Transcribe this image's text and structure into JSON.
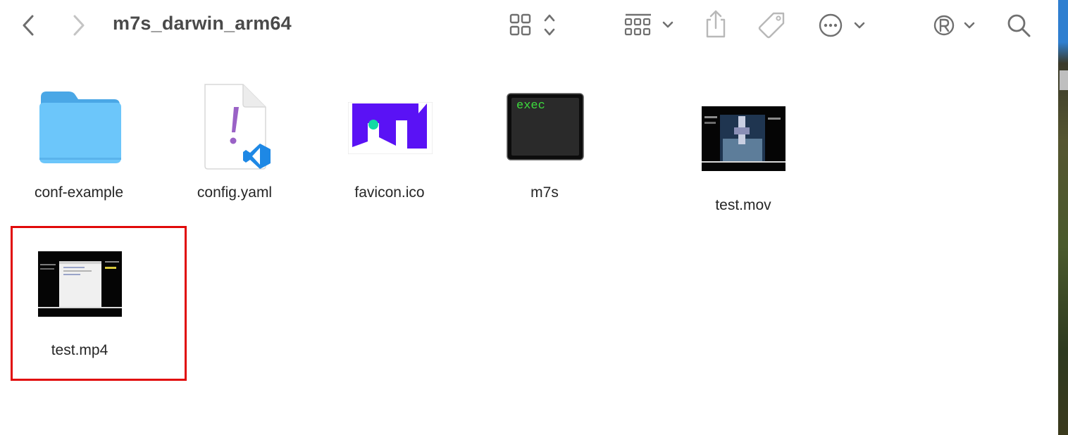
{
  "window": {
    "title": "m7s_darwin_arm64"
  },
  "toolbar": {
    "back": "back-icon",
    "forward": "forward-icon",
    "view_mode": "icon-grid-view",
    "group": "group-by-icon",
    "share": "share-icon",
    "tags": "tag-icon",
    "more": "more-actions-icon",
    "extension": "registered-icon",
    "search": "search-icon"
  },
  "files": [
    {
      "name": "conf-example",
      "kind": "folder"
    },
    {
      "name": "config.yaml",
      "kind": "yaml"
    },
    {
      "name": "favicon.ico",
      "kind": "ico"
    },
    {
      "name": "m7s",
      "kind": "exec",
      "badge": "exec"
    },
    {
      "name": "test.mov",
      "kind": "video"
    },
    {
      "name": "test.mp4",
      "kind": "video",
      "selected": true
    }
  ],
  "colors": {
    "folder": "#5ebdf5",
    "selection_border": "#e10a0a",
    "exec_text": "#3ddc3d",
    "favicon_purple": "#5a12f5",
    "favicon_dot": "#12d9a4",
    "yaml_mark": "#9a62c6",
    "vscode_blue": "#1e88e5"
  }
}
